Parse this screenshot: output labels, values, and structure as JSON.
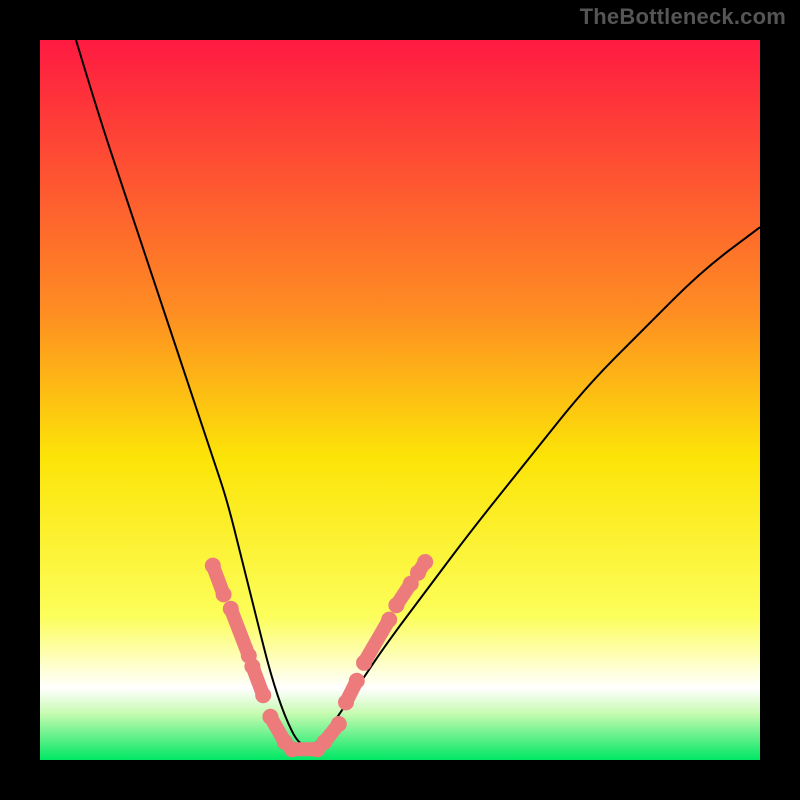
{
  "attribution": "TheBottleneck.com",
  "colors": {
    "gradient_top": "#fe1a41",
    "gradient_mid_upper": "#fe8e22",
    "gradient_mid": "#fce407",
    "gradient_lower": "#fcfe5a",
    "gradient_white": "#ffffff",
    "gradient_bottom": "#00e764",
    "curve": "#000000",
    "marker": "#ed7b7c",
    "frame": "#000000"
  },
  "chart_data": {
    "type": "line",
    "title": "",
    "xlabel": "",
    "ylabel": "",
    "xlim": [
      0,
      100
    ],
    "ylim": [
      0,
      100
    ],
    "series": [
      {
        "name": "bottleneck-curve",
        "x": [
          5,
          8,
          12,
          16,
          20,
          24,
          26,
          28,
          30,
          32,
          34,
          36,
          38,
          40,
          44,
          48,
          54,
          60,
          68,
          76,
          84,
          92,
          100
        ],
        "y": [
          100,
          90,
          78,
          66,
          54,
          42,
          36,
          28,
          20,
          12,
          6,
          2,
          2,
          4,
          10,
          16,
          24,
          32,
          42,
          52,
          60,
          68,
          74
        ]
      }
    ],
    "markers": {
      "name": "highlight-beads",
      "segments": [
        {
          "x": [
            24.0,
            25.5
          ],
          "y": [
            27.0,
            23.0
          ]
        },
        {
          "x": [
            26.5,
            29.0
          ],
          "y": [
            21.0,
            14.5
          ]
        },
        {
          "x": [
            29.5,
            31.0
          ],
          "y": [
            13.0,
            9.0
          ]
        },
        {
          "x": [
            32.0,
            34.0
          ],
          "y": [
            6.0,
            2.5
          ]
        },
        {
          "x": [
            35.0,
            38.5
          ],
          "y": [
            1.5,
            1.5
          ]
        },
        {
          "x": [
            39.5,
            41.5
          ],
          "y": [
            2.5,
            5.0
          ]
        },
        {
          "x": [
            42.5,
            44.0
          ],
          "y": [
            8.0,
            11.0
          ]
        },
        {
          "x": [
            45.0,
            48.5
          ],
          "y": [
            13.5,
            19.5
          ]
        },
        {
          "x": [
            49.5,
            51.5
          ],
          "y": [
            21.5,
            24.5
          ]
        },
        {
          "x": [
            52.5,
            53.5
          ],
          "y": [
            26.0,
            27.5
          ]
        }
      ]
    },
    "gradient_stops": [
      {
        "offset": 0.0,
        "color": "#fe1a41"
      },
      {
        "offset": 0.38,
        "color": "#fe8e22"
      },
      {
        "offset": 0.58,
        "color": "#fce407"
      },
      {
        "offset": 0.8,
        "color": "#fcfe5a"
      },
      {
        "offset": 0.9,
        "color": "#ffffff"
      },
      {
        "offset": 0.935,
        "color": "#c7fbb1"
      },
      {
        "offset": 1.0,
        "color": "#00e764"
      }
    ]
  }
}
